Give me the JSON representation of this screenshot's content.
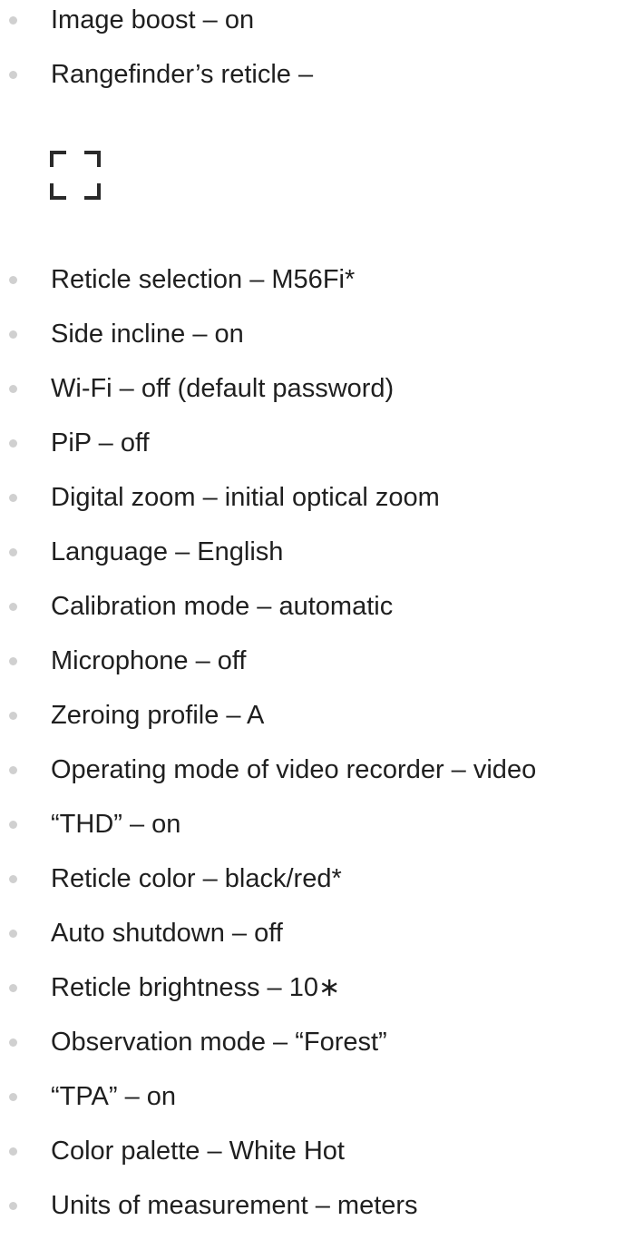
{
  "items_top": [
    {
      "label": "Image boost – on"
    },
    {
      "label": "Rangefinder’s reticle –"
    }
  ],
  "rangefinder_reticle_icon": "rangefinder-reticle-brackets-icon",
  "items_bottom": [
    {
      "label": "Reticle selection – M56Fi*"
    },
    {
      "label": "Side incline – on"
    },
    {
      "label": "Wi-Fi – off (default password)"
    },
    {
      "label": "PiP – off"
    },
    {
      "label": "Digital zoom – initial optical zoom"
    },
    {
      "label": "Language – English"
    },
    {
      "label": "Calibration mode – automatic"
    },
    {
      "label": "Microphone – off"
    },
    {
      "label": "Zeroing profile – A"
    },
    {
      "label": "Operating mode of video recorder – video"
    },
    {
      "label": "“THD” – on"
    },
    {
      "label": "Reticle color – black/red*"
    },
    {
      "label": "Auto shutdown – off"
    },
    {
      "label": "Reticle brightness – 10∗"
    },
    {
      "label": "Observation mode – “Forest”"
    },
    {
      "label": "“TPA” – on"
    },
    {
      "label": "Color palette – White Hot"
    },
    {
      "label": "Units of measurement – meters"
    }
  ],
  "colors": {
    "text": "#1f1f1f",
    "bullet": "#d0d0d0",
    "icon": "#2a2a2a"
  }
}
